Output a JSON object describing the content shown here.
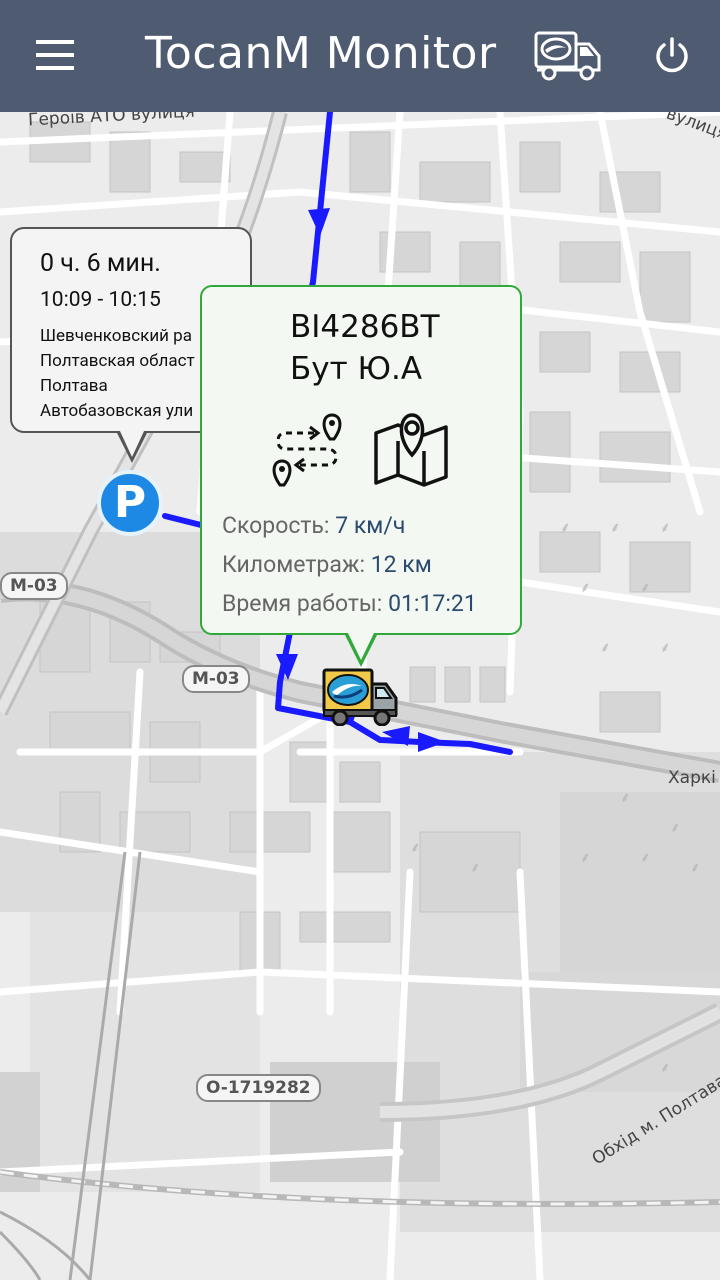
{
  "appbar": {
    "title": "TocanM Monitor",
    "menu_icon": "hamburger-menu-icon",
    "vehicles_icon": "delivery-truck-icon",
    "power_icon": "power-icon",
    "background": "#4f5b70"
  },
  "parking_popup": {
    "duration": "0 ч. 6 мин.",
    "time_range": "10:09 - 10:15",
    "address_lines": [
      "Шевченковский ра",
      "Полтавская област",
      "Полтава",
      "Автобазовская ули"
    ],
    "marker_letter": "P"
  },
  "vehicle_popup": {
    "plate": "BI4286BT",
    "driver": "Бут Ю.А",
    "route_icon": "route-icon",
    "map_icon": "map-icon",
    "speed_label": "Скорость:",
    "speed_value": "7 км/ч",
    "mileage_label": "Километраж:",
    "mileage_value": "12 км",
    "worktime_label": "Время работы:",
    "worktime_value": "01:17:21",
    "border_color": "#31a83a"
  },
  "map": {
    "street_labels": [
      "Героїв АТО вулиця",
      "вулиця",
      "Харкі",
      "Обхід м. Полтава (Ш"
    ],
    "road_labels": [
      "M-03",
      "M-03",
      "O-1719282"
    ],
    "track_color": "#1a1aff"
  }
}
